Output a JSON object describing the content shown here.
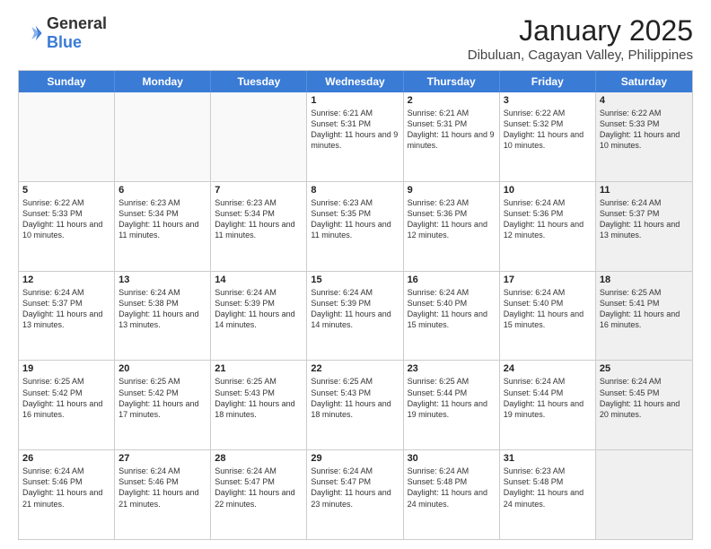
{
  "logo": {
    "general": "General",
    "blue": "Blue"
  },
  "header": {
    "month": "January 2025",
    "location": "Dibuluan, Cagayan Valley, Philippines"
  },
  "weekdays": [
    "Sunday",
    "Monday",
    "Tuesday",
    "Wednesday",
    "Thursday",
    "Friday",
    "Saturday"
  ],
  "weeks": [
    [
      {
        "day": "",
        "info": "",
        "empty": true
      },
      {
        "day": "",
        "info": "",
        "empty": true
      },
      {
        "day": "",
        "info": "",
        "empty": true
      },
      {
        "day": "1",
        "info": "Sunrise: 6:21 AM\nSunset: 5:31 PM\nDaylight: 11 hours and 9 minutes."
      },
      {
        "day": "2",
        "info": "Sunrise: 6:21 AM\nSunset: 5:31 PM\nDaylight: 11 hours and 9 minutes."
      },
      {
        "day": "3",
        "info": "Sunrise: 6:22 AM\nSunset: 5:32 PM\nDaylight: 11 hours and 10 minutes."
      },
      {
        "day": "4",
        "info": "Sunrise: 6:22 AM\nSunset: 5:33 PM\nDaylight: 11 hours and 10 minutes.",
        "shaded": true
      }
    ],
    [
      {
        "day": "5",
        "info": "Sunrise: 6:22 AM\nSunset: 5:33 PM\nDaylight: 11 hours and 10 minutes."
      },
      {
        "day": "6",
        "info": "Sunrise: 6:23 AM\nSunset: 5:34 PM\nDaylight: 11 hours and 11 minutes."
      },
      {
        "day": "7",
        "info": "Sunrise: 6:23 AM\nSunset: 5:34 PM\nDaylight: 11 hours and 11 minutes."
      },
      {
        "day": "8",
        "info": "Sunrise: 6:23 AM\nSunset: 5:35 PM\nDaylight: 11 hours and 11 minutes."
      },
      {
        "day": "9",
        "info": "Sunrise: 6:23 AM\nSunset: 5:36 PM\nDaylight: 11 hours and 12 minutes."
      },
      {
        "day": "10",
        "info": "Sunrise: 6:24 AM\nSunset: 5:36 PM\nDaylight: 11 hours and 12 minutes."
      },
      {
        "day": "11",
        "info": "Sunrise: 6:24 AM\nSunset: 5:37 PM\nDaylight: 11 hours and 13 minutes.",
        "shaded": true
      }
    ],
    [
      {
        "day": "12",
        "info": "Sunrise: 6:24 AM\nSunset: 5:37 PM\nDaylight: 11 hours and 13 minutes."
      },
      {
        "day": "13",
        "info": "Sunrise: 6:24 AM\nSunset: 5:38 PM\nDaylight: 11 hours and 13 minutes."
      },
      {
        "day": "14",
        "info": "Sunrise: 6:24 AM\nSunset: 5:39 PM\nDaylight: 11 hours and 14 minutes."
      },
      {
        "day": "15",
        "info": "Sunrise: 6:24 AM\nSunset: 5:39 PM\nDaylight: 11 hours and 14 minutes."
      },
      {
        "day": "16",
        "info": "Sunrise: 6:24 AM\nSunset: 5:40 PM\nDaylight: 11 hours and 15 minutes."
      },
      {
        "day": "17",
        "info": "Sunrise: 6:24 AM\nSunset: 5:40 PM\nDaylight: 11 hours and 15 minutes."
      },
      {
        "day": "18",
        "info": "Sunrise: 6:25 AM\nSunset: 5:41 PM\nDaylight: 11 hours and 16 minutes.",
        "shaded": true
      }
    ],
    [
      {
        "day": "19",
        "info": "Sunrise: 6:25 AM\nSunset: 5:42 PM\nDaylight: 11 hours and 16 minutes."
      },
      {
        "day": "20",
        "info": "Sunrise: 6:25 AM\nSunset: 5:42 PM\nDaylight: 11 hours and 17 minutes."
      },
      {
        "day": "21",
        "info": "Sunrise: 6:25 AM\nSunset: 5:43 PM\nDaylight: 11 hours and 18 minutes."
      },
      {
        "day": "22",
        "info": "Sunrise: 6:25 AM\nSunset: 5:43 PM\nDaylight: 11 hours and 18 minutes."
      },
      {
        "day": "23",
        "info": "Sunrise: 6:25 AM\nSunset: 5:44 PM\nDaylight: 11 hours and 19 minutes."
      },
      {
        "day": "24",
        "info": "Sunrise: 6:24 AM\nSunset: 5:44 PM\nDaylight: 11 hours and 19 minutes."
      },
      {
        "day": "25",
        "info": "Sunrise: 6:24 AM\nSunset: 5:45 PM\nDaylight: 11 hours and 20 minutes.",
        "shaded": true
      }
    ],
    [
      {
        "day": "26",
        "info": "Sunrise: 6:24 AM\nSunset: 5:46 PM\nDaylight: 11 hours and 21 minutes."
      },
      {
        "day": "27",
        "info": "Sunrise: 6:24 AM\nSunset: 5:46 PM\nDaylight: 11 hours and 21 minutes."
      },
      {
        "day": "28",
        "info": "Sunrise: 6:24 AM\nSunset: 5:47 PM\nDaylight: 11 hours and 22 minutes."
      },
      {
        "day": "29",
        "info": "Sunrise: 6:24 AM\nSunset: 5:47 PM\nDaylight: 11 hours and 23 minutes."
      },
      {
        "day": "30",
        "info": "Sunrise: 6:24 AM\nSunset: 5:48 PM\nDaylight: 11 hours and 24 minutes."
      },
      {
        "day": "31",
        "info": "Sunrise: 6:23 AM\nSunset: 5:48 PM\nDaylight: 11 hours and 24 minutes."
      },
      {
        "day": "",
        "info": "",
        "empty": true,
        "shaded": true
      }
    ]
  ]
}
